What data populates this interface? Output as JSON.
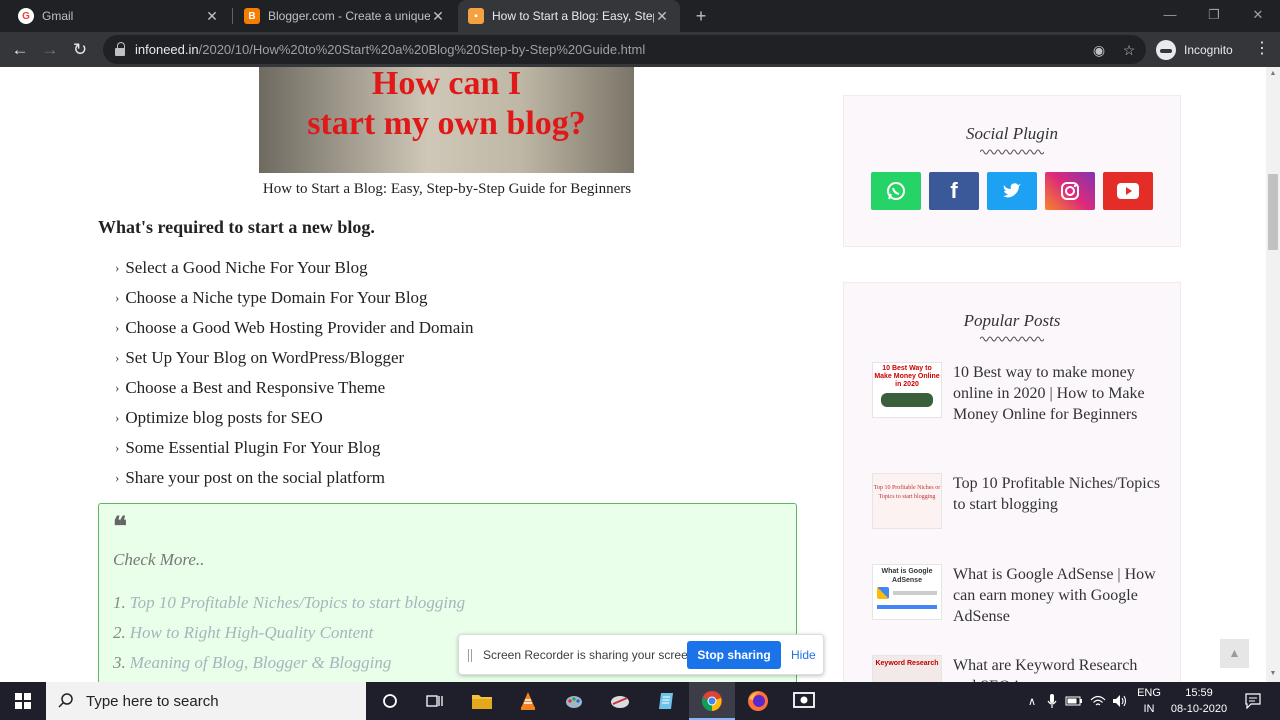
{
  "browser": {
    "tabs": [
      {
        "title": "Gmail",
        "favicon": "gmail-icon",
        "favicon_color": "#ea4335",
        "active": false
      },
      {
        "title": "Blogger.com - Create a unique a",
        "favicon": "blogger-icon",
        "favicon_color": "#f57d00",
        "active": false
      },
      {
        "title": "How to Start a Blog: Easy, Step-b",
        "favicon": "page-icon",
        "favicon_color": "#f4a142",
        "active": true
      }
    ],
    "url_host": "infoneed.in",
    "url_path": "/2020/10/How%20to%20Start%20a%20Blog%20Step-by-Step%20Guide.html",
    "incognito_label": "Incognito"
  },
  "article": {
    "hero_line1": "How can I",
    "hero_line2": "start my own blog?",
    "caption": "How to Start a Blog: Easy, Step-by-Step Guide for Beginners",
    "section_heading": "What's required to start a new blog.",
    "requirements": [
      "Select a Good Niche For Your Blog",
      "Choose a Niche type Domain For Your Blog",
      "Choose a Good Web Hosting Provider and Domain",
      "Set Up Your Blog on WordPress/Blogger",
      "Choose a Best and Responsive Theme",
      "Optimize blog posts for SEO",
      "Some Essential Plugin For Your Blog",
      "Share your post on the social platform"
    ],
    "quote_mark": "❝",
    "check_more_label": "Check More..",
    "more_links": [
      {
        "num": "1.",
        "text": "Top 10 Profitable Niches/Topics to start blogging"
      },
      {
        "num": "2.",
        "text": "How to Right High-Quality Content"
      },
      {
        "num": "3.",
        "text": "Meaning of Blog, Blogger & Blogging"
      }
    ]
  },
  "sidebar": {
    "social_title": "Social Plugin",
    "social_buttons": [
      {
        "name": "whatsapp-icon",
        "color": "#25d366",
        "glyph": "✆"
      },
      {
        "name": "facebook-icon",
        "color": "#3b5998",
        "glyph": "f"
      },
      {
        "name": "twitter-icon",
        "color": "#1da1f2",
        "glyph": "🐦"
      },
      {
        "name": "instagram-icon",
        "color": "#dd2a7b",
        "glyph": "◎"
      },
      {
        "name": "youtube-icon",
        "color": "#e52d27",
        "glyph": "▶"
      }
    ],
    "popular_title": "Popular Posts",
    "posts": [
      {
        "title": "10 Best way to make money online in 2020 | How to Make Money Online for Beginners",
        "thumb_text": "10 Best Way to Make Money Online in 2020"
      },
      {
        "title": "Top 10 Profitable Niches/Topics to start blogging",
        "thumb_text": "Top 10 Profitable Niches or Topics to start blogging"
      },
      {
        "title": "What is Google AdSense | How can earn money with Google AdSense",
        "thumb_text": "What is Google AdSense"
      },
      {
        "title": "What are Keyword Research and SEO in",
        "thumb_text": "Keyword Research"
      }
    ]
  },
  "share_notice": {
    "text": "Screen Recorder is sharing your screen.",
    "stop_label": "Stop sharing",
    "hide_label": "Hide"
  },
  "taskbar": {
    "search_placeholder": "Type here to search",
    "lang_line1": "ENG",
    "lang_line2": "IN",
    "time": "15:59",
    "date": "08-10-2020"
  }
}
